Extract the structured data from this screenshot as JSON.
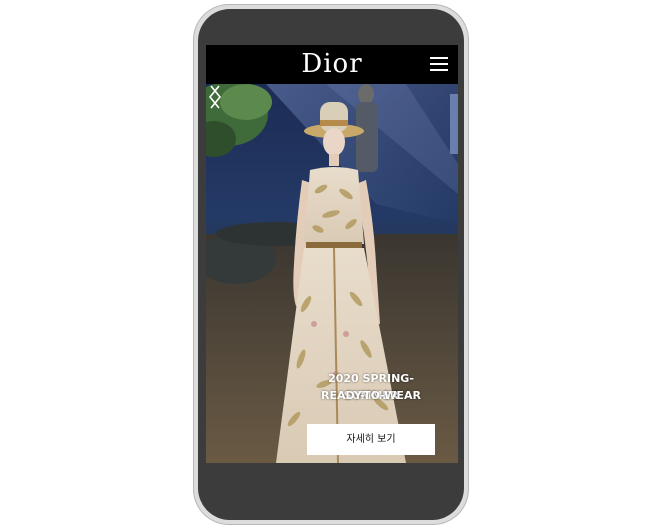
{
  "header": {
    "logo_text": "Dior",
    "menu_icon": "hamburger-menu-icon"
  },
  "hero": {
    "title_line1": "2020 SPRING-SUMMER",
    "title_line2": "READY-TO-WEAR",
    "cta_label": "자세히 보기",
    "prev_icon": "chevron-left-icon",
    "next_icon": "chevron-right-icon"
  },
  "colors": {
    "header_bg": "#000000",
    "phone_bezel": "#3c3c3c",
    "phone_frame": "#dcdcdc",
    "cta_bg": "#ffffff"
  }
}
